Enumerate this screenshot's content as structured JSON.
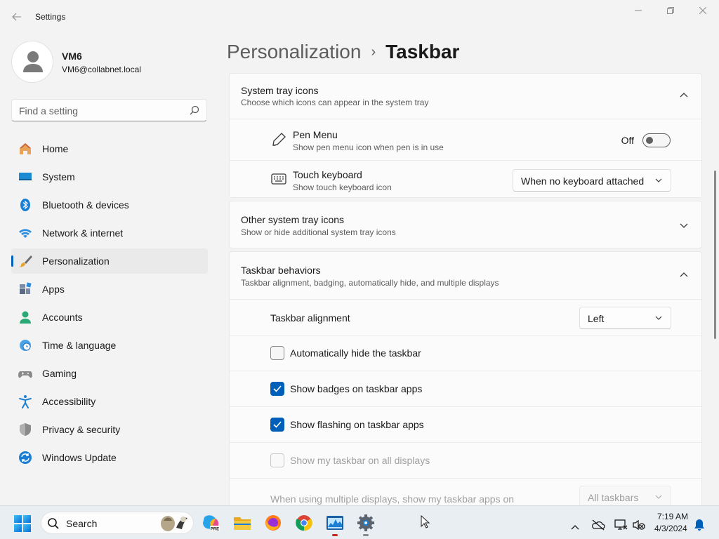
{
  "window": {
    "title": "Settings",
    "back_icon": "back-arrow-icon",
    "controls": [
      "minimize",
      "maximize",
      "close"
    ]
  },
  "user": {
    "name": "VM6",
    "email": "VM6@collabnet.local"
  },
  "search": {
    "placeholder": "Find a setting"
  },
  "sidebar": {
    "items": [
      {
        "label": "Home",
        "icon": "home-icon"
      },
      {
        "label": "System",
        "icon": "system-icon"
      },
      {
        "label": "Bluetooth & devices",
        "icon": "bluetooth-icon"
      },
      {
        "label": "Network & internet",
        "icon": "wifi-icon"
      },
      {
        "label": "Personalization",
        "icon": "brush-icon",
        "active": true
      },
      {
        "label": "Apps",
        "icon": "apps-icon"
      },
      {
        "label": "Accounts",
        "icon": "accounts-icon"
      },
      {
        "label": "Time & language",
        "icon": "clock-globe-icon"
      },
      {
        "label": "Gaming",
        "icon": "gamepad-icon"
      },
      {
        "label": "Accessibility",
        "icon": "accessibility-icon"
      },
      {
        "label": "Privacy & security",
        "icon": "shield-icon"
      },
      {
        "label": "Windows Update",
        "icon": "update-icon"
      }
    ]
  },
  "breadcrumb": {
    "parent": "Personalization",
    "separator": "›",
    "current": "Taskbar"
  },
  "system_tray_icons": {
    "title": "System tray icons",
    "subtitle": "Choose which icons can appear in the system tray",
    "expanded": true,
    "pen_menu": {
      "title": "Pen Menu",
      "subtitle": "Show pen menu icon when pen is in use",
      "state_label": "Off",
      "on": false
    },
    "touch_keyboard": {
      "title": "Touch keyboard",
      "subtitle": "Show touch keyboard icon",
      "value": "When no keyboard attached"
    }
  },
  "other_tray_icons": {
    "title": "Other system tray icons",
    "subtitle": "Show or hide additional system tray icons",
    "expanded": false
  },
  "taskbar_behaviors": {
    "title": "Taskbar behaviors",
    "subtitle": "Taskbar alignment, badging, automatically hide, and multiple displays",
    "expanded": true,
    "alignment": {
      "label": "Taskbar alignment",
      "value": "Left"
    },
    "checkboxes": [
      {
        "label": "Automatically hide the taskbar",
        "checked": false,
        "disabled": false
      },
      {
        "label": "Show badges on taskbar apps",
        "checked": true,
        "disabled": false
      },
      {
        "label": "Show flashing on taskbar apps",
        "checked": true,
        "disabled": false
      },
      {
        "label": "Show my taskbar on all displays",
        "checked": false,
        "disabled": true
      }
    ],
    "multi_display": {
      "label": "When using multiple displays, show my taskbar apps on",
      "value": "All taskbars",
      "disabled": true
    }
  },
  "taskbar": {
    "search_label": "Search",
    "apps": [
      {
        "name": "copilot-pre-icon"
      },
      {
        "name": "file-explorer-icon"
      },
      {
        "name": "firefox-icon"
      },
      {
        "name": "chrome-icon"
      },
      {
        "name": "task-manager-icon",
        "running": true
      },
      {
        "name": "settings-icon",
        "running": true
      }
    ],
    "time": "7:19 AM",
    "date": "4/3/2024"
  },
  "colors": {
    "accent": "#005fb8",
    "background": "#f3f3f3",
    "card": "#fbfbfb"
  }
}
